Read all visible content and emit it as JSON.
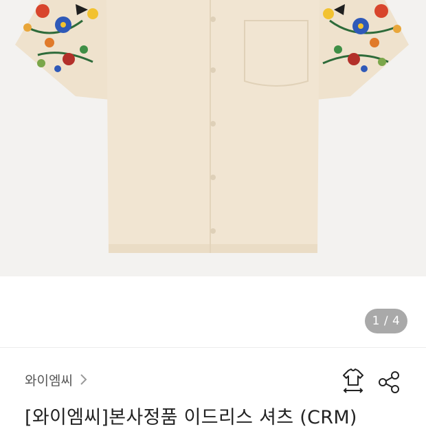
{
  "gallery": {
    "counter": "1 / 4",
    "image_alt": "product-photo"
  },
  "product": {
    "brand": "와이엠씨",
    "title": "[와이엠씨]본사정품 이드리스 셔츠 (CRM)"
  },
  "icons": {
    "size_guide": "shirt-size-icon",
    "share": "share-icon",
    "brand_chevron": "chevron-right-icon"
  },
  "colors": {
    "counter_bg": "#a9a9a9",
    "shirt": "#f1e5d2"
  }
}
